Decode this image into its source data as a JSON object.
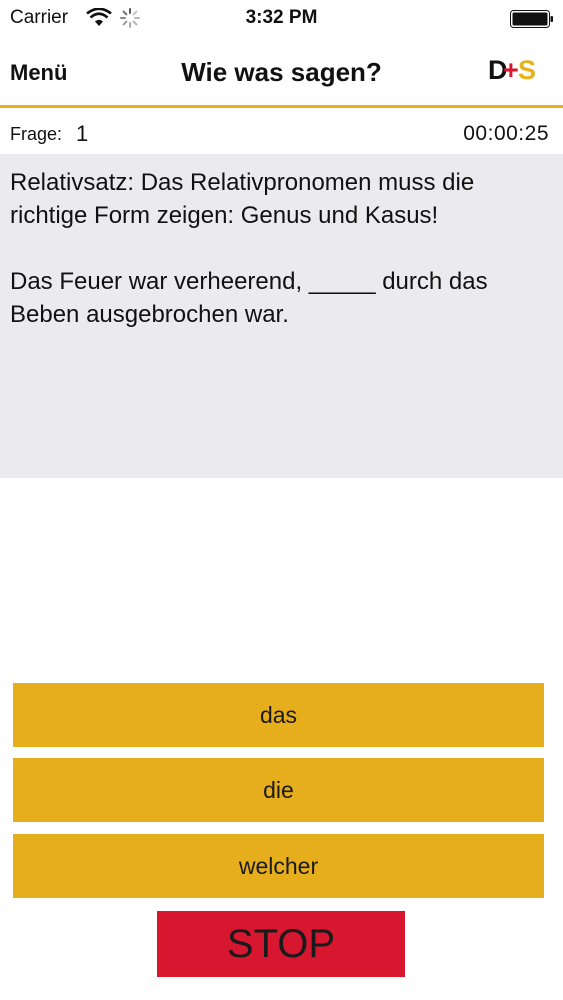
{
  "status_bar": {
    "carrier": "Carrier",
    "time": "3:32 PM",
    "wifi_icon": "wifi-icon",
    "activity_icon": "activity-spinner-icon",
    "battery_icon": "battery-icon"
  },
  "nav": {
    "menu_label": "Menü",
    "title": "Wie was sagen?",
    "logo_text": "D+S",
    "accent_color": "#e8b21a"
  },
  "question": {
    "label": "Frage:",
    "number": "1",
    "timer": "00:00:25",
    "text": "Relativsatz: Das Relativpronomen muss die richtige Form zeigen: Genus und Kasus!\n\nDas Feuer war verheerend, _____ durch das Beben ausgebrochen war."
  },
  "answers": [
    {
      "label": "das"
    },
    {
      "label": "die"
    },
    {
      "label": "welcher"
    }
  ],
  "stop": {
    "label": "STOP",
    "color": "#d7172f"
  },
  "colors": {
    "answer_background": "#e6ae1c",
    "question_background": "#ebeaee"
  }
}
